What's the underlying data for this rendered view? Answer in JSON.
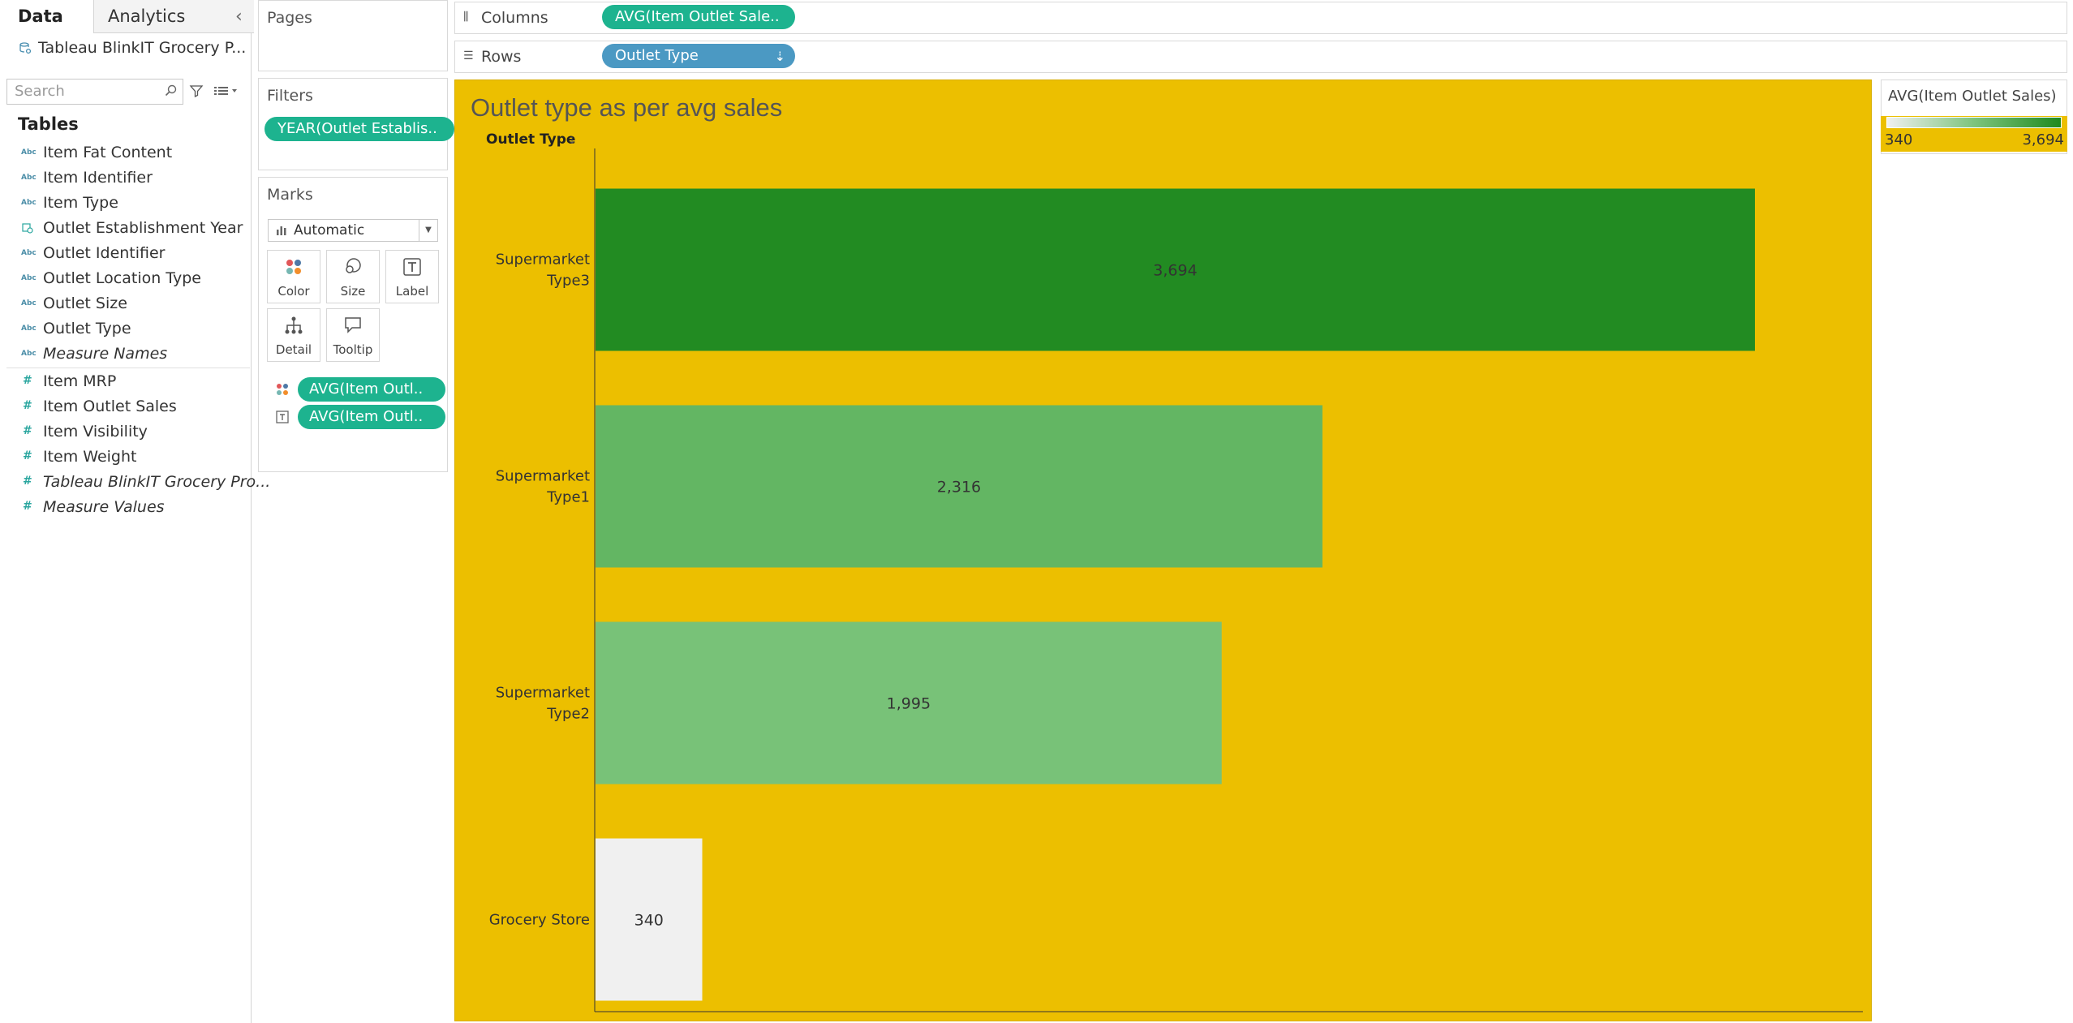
{
  "left_pane": {
    "tabs": [
      "Data",
      "Analytics"
    ],
    "datasource": "Tableau BlinkIT Grocery P...",
    "search_placeholder": "Search",
    "tables_heading": "Tables",
    "dimensions": [
      {
        "label": "Item Fat Content",
        "type": "abc"
      },
      {
        "label": "Item Identifier",
        "type": "abc"
      },
      {
        "label": "Item Type",
        "type": "abc"
      },
      {
        "label": "Outlet Establishment Year",
        "type": "date"
      },
      {
        "label": "Outlet Identifier",
        "type": "abc"
      },
      {
        "label": "Outlet Location Type",
        "type": "abc"
      },
      {
        "label": "Outlet Size",
        "type": "abc"
      },
      {
        "label": "Outlet Type",
        "type": "abc"
      },
      {
        "label": "Measure Names",
        "type": "abc",
        "italic": true
      }
    ],
    "measures": [
      {
        "label": "Item MRP",
        "type": "num"
      },
      {
        "label": "Item Outlet Sales",
        "type": "num"
      },
      {
        "label": "Item Visibility",
        "type": "num"
      },
      {
        "label": "Item Weight",
        "type": "num"
      },
      {
        "label": "Tableau BlinkIT Grocery Pro...",
        "type": "num",
        "italic": true
      },
      {
        "label": "Measure Values",
        "type": "num",
        "italic": true
      }
    ],
    "abc_glyph": "Abc",
    "num_glyph": "#"
  },
  "shelves": {
    "pages_title": "Pages",
    "filters_title": "Filters",
    "filter_pill": "YEAR(Outlet Establis..",
    "marks_title": "Marks",
    "mark_type": "Automatic",
    "mark_buttons": [
      "Color",
      "Size",
      "Label",
      "Detail",
      "Tooltip"
    ],
    "mark_pills": [
      "AVG(Item Outl..",
      "AVG(Item Outl.."
    ],
    "columns_label": "Columns",
    "columns_pill": "AVG(Item Outlet Sale..",
    "rows_label": "Rows",
    "rows_pill": "Outlet Type"
  },
  "legend": {
    "title": "AVG(Item Outlet Sales)",
    "min": "340",
    "max": "3,694"
  },
  "colors": {
    "view_background": "#ecbf00",
    "pill_green": "#1db38f",
    "pill_blue": "#4b99c3",
    "bar_low": "#f0f0f0",
    "bar_high": "#228b22"
  },
  "chart_data": {
    "type": "bar",
    "orientation": "horizontal",
    "title": "Outlet type as per avg sales",
    "row_header": "Outlet Type",
    "categories": [
      "Supermarket\nType3",
      "Supermarket\nType1",
      "Supermarket\nType2",
      "Grocery Store"
    ],
    "values": [
      3694,
      2316,
      1995,
      340
    ],
    "labels": [
      "3,694",
      "2,316",
      "1,995",
      "340"
    ],
    "bar_colors": [
      "#228b22",
      "#63b663",
      "#78c278",
      "#f0f0f0"
    ],
    "xlim": [
      0,
      3950
    ],
    "color_range": [
      340,
      3694
    ]
  }
}
